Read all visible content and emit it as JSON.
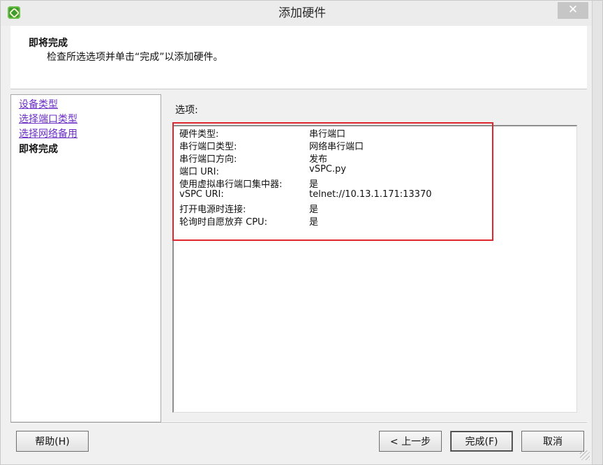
{
  "window": {
    "title": "添加硬件",
    "close_label": "✕"
  },
  "header": {
    "title": "即将完成",
    "subtitle": "检查所选选项并单击“完成”以添加硬件。"
  },
  "nav": {
    "items": [
      {
        "label": "设备类型",
        "current": false
      },
      {
        "label": "选择端口类型",
        "current": false
      },
      {
        "label": "选择网络备用",
        "current": false
      },
      {
        "label": "即将完成",
        "current": true
      }
    ]
  },
  "main": {
    "options_label": "选项:",
    "rows": [
      {
        "key": "硬件类型:",
        "value": "串行端口"
      },
      {
        "key": "串行端口类型:",
        "value": "网络串行端口"
      },
      {
        "key": "串行端口方向:",
        "value": "发布"
      },
      {
        "key": "端口 URI:",
        "value": "vSPC.py"
      },
      {
        "key": "使用虚拟串行端口集中器:",
        "value": "是"
      },
      {
        "key": "vSPC URI:",
        "value": "telnet://10.13.1.171:13370"
      },
      {
        "key": "打开电源时连接:",
        "value": "是"
      },
      {
        "key": "轮询时自愿放弃 CPU:",
        "value": "是"
      }
    ],
    "highlight_color": "#e0262d"
  },
  "footer": {
    "help_label": "帮助(H)",
    "back_label": "< 上一步",
    "finish_label": "完成(F)",
    "cancel_label": "取消"
  }
}
